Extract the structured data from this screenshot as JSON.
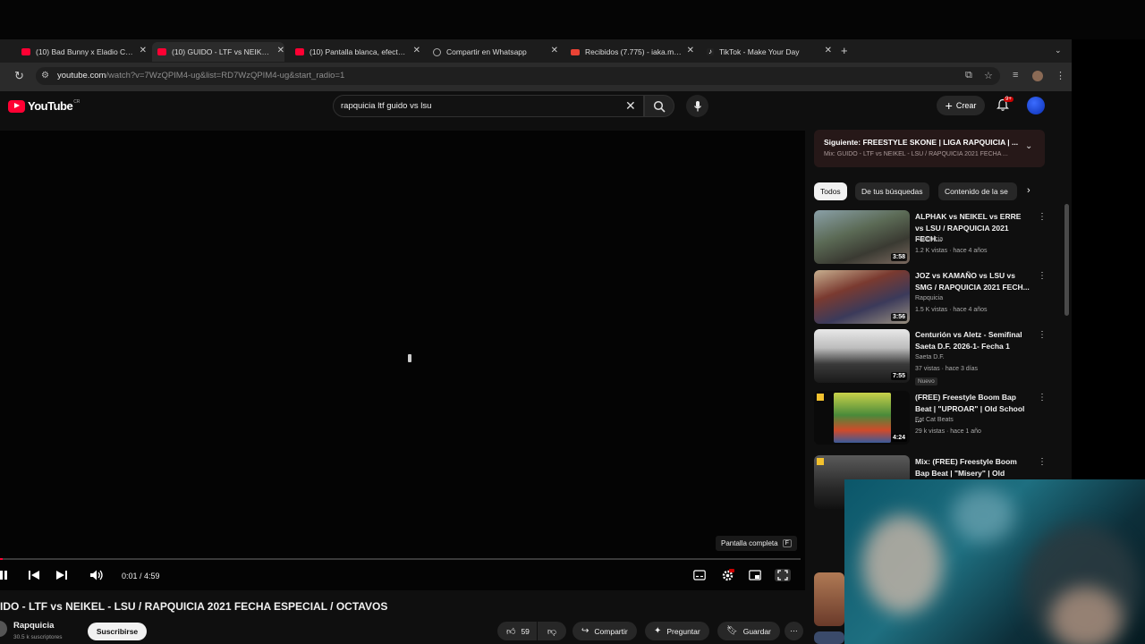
{
  "browser": {
    "tabs": [
      {
        "title": "(10) Bad Bunny x Eladio Carri",
        "active": false,
        "icon": "youtube-icon"
      },
      {
        "title": "(10) GUIDO - LTF vs NEIKEL - ",
        "active": true,
        "icon": "youtube-icon"
      },
      {
        "title": "(10) Pantalla blanca, efecto a",
        "active": false,
        "icon": "youtube-icon"
      },
      {
        "title": "Compartir en Whatsapp",
        "active": false,
        "icon": "globe-icon"
      },
      {
        "title": "Recibidos (7.775) - iaka.musi",
        "active": false,
        "icon": "gmail-icon"
      },
      {
        "title": "TikTok - Make Your Day",
        "active": false,
        "icon": "tiktok-icon"
      }
    ],
    "url_host": "youtube.com",
    "url_rest": "/watch?v=7WzQPIM4-ug&list=RD7WzQPIM4-ug&start_radio=1"
  },
  "youtube": {
    "logo_text": "YouTube",
    "logo_country": "CR",
    "search_query": "rapquicia ltf guido vs lsu",
    "create_label": "Crear",
    "notifications_badge": "9+"
  },
  "player": {
    "fullscreen_tooltip": "Pantalla completa",
    "fullscreen_key": "F",
    "time": "0:01 / 4:59",
    "progress": 0.003
  },
  "video": {
    "title": "IDO - LTF vs NEIKEL - LSU / RAPQUICIA 2021 FECHA ESPECIAL / OCTAVOS",
    "channel": "Rapquicia",
    "subscribers": "30.5 k suscriptores",
    "subscribe_label": "Suscribirse",
    "likes": "59",
    "share_label": "Compartir",
    "ask_label": "Preguntar",
    "save_label": "Guardar"
  },
  "sidebar": {
    "up_next_title": "Siguiente: FREESTYLE SKONE | LIGA RAPQUICIA | ...",
    "up_next_sub": "Mix: GUIDO - LTF vs NEIKEL - LSU / RAPQUICIA 2021 FECHA ...",
    "chips": [
      "Todos",
      "De tus búsquedas",
      "Contenido de la se"
    ],
    "videos": [
      {
        "title": "ALPHAK vs NEIKEL vs ERRE vs LSU / RAPQUICIA 2021 FECH...",
        "channel": "Rapquicia",
        "meta": "1.2 K vistas · hace 4 años",
        "duration": "3:58"
      },
      {
        "title": "JOZ vs KAMAÑO vs LSU vs SMG / RAPQUICIA 2021 FECH...",
        "channel": "Rapquicia",
        "meta": "1.5 K vistas · hace 4 años",
        "duration": "3:56"
      },
      {
        "title": "Centurión vs Aletz - Semifinal Saeta D.F. 2026-1- Fecha 1",
        "channel": "Saeta D.F.",
        "meta": "37 vistas · hace 3 días",
        "duration": "7:55",
        "badge": "Nuevo"
      },
      {
        "title": "(FREE) Freestyle Boom Bap Beat | \"UPROAR\" | Old School ...",
        "channel": "Fat Cat Beats",
        "meta": "29 k vistas · hace 1 año",
        "duration": "4:24"
      },
      {
        "title": "Mix: (FREE) Freestyle Boom Bap Beat | \"Misery\" | Old School Hi...",
        "channel": "",
        "meta": "",
        "duration": ""
      }
    ]
  },
  "colors": {
    "accent": "#ff0033",
    "background": "#0f0f0f",
    "chip_bg": "#272727"
  }
}
